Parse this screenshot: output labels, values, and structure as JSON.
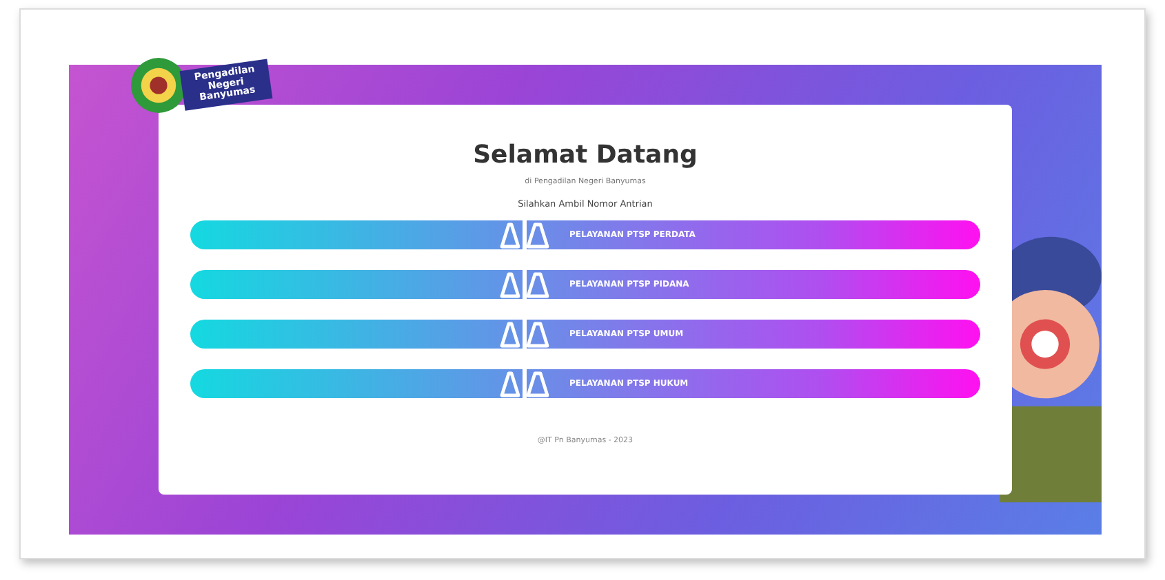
{
  "logo": {
    "title": "Pengadilan Negeri Banyumas"
  },
  "card": {
    "title": "Selamat Datang",
    "subtitle": "di Pengadilan Negeri Banyumas",
    "prompt": "Silahkan Ambil Nomor Antrian",
    "services": [
      {
        "label": "PELAYANAN PTSP PERDATA"
      },
      {
        "label": "PELAYANAN PTSP PIDANA"
      },
      {
        "label": "PELAYANAN PTSP UMUM"
      },
      {
        "label": "PELAYANAN PTSP HUKUM"
      }
    ],
    "footer": "@IT Pn Banyumas - 2023"
  }
}
